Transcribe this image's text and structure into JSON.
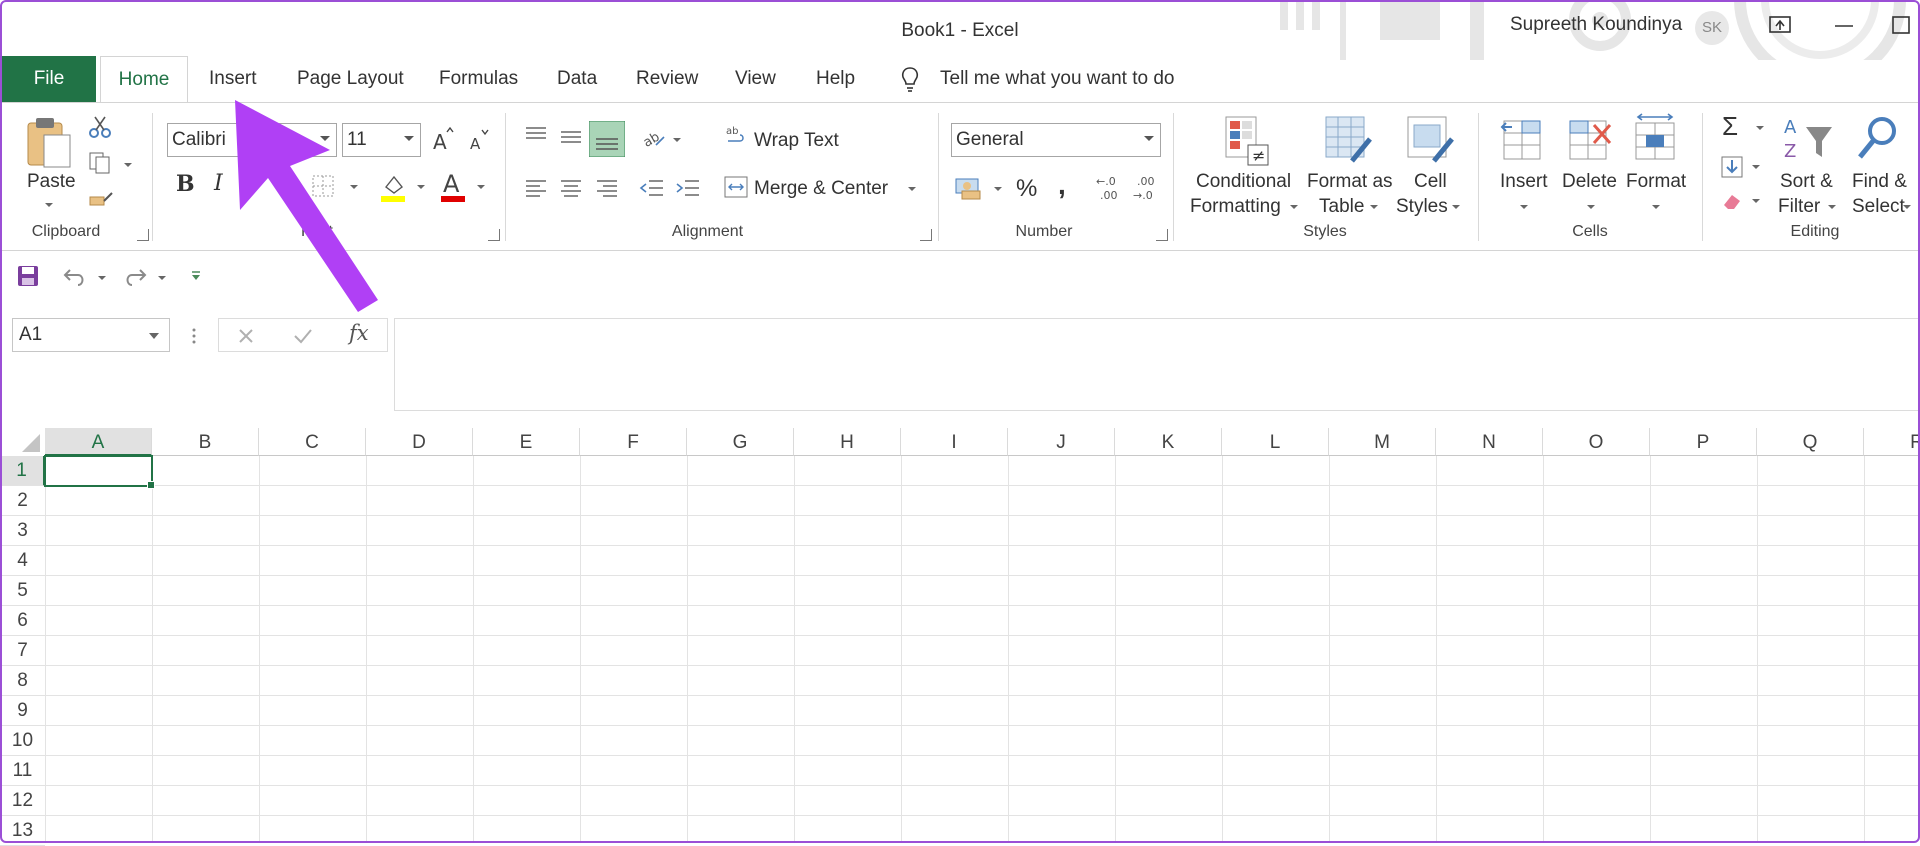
{
  "window": {
    "title": "Book1  -  Excel",
    "user_name": "Supreeth Koundinya",
    "user_initials": "SK"
  },
  "tabs": [
    {
      "label": "File"
    },
    {
      "label": "Home"
    },
    {
      "label": "Insert"
    },
    {
      "label": "Page Layout"
    },
    {
      "label": "Formulas"
    },
    {
      "label": "Data"
    },
    {
      "label": "Review"
    },
    {
      "label": "View"
    },
    {
      "label": "Help"
    }
  ],
  "tell_me": "Tell me what you want to do",
  "ribbon": {
    "clipboard": {
      "label": "Clipboard",
      "paste": "Paste"
    },
    "font": {
      "label": "Font",
      "font_name": "Calibri",
      "font_size": "11",
      "bold": "B",
      "italic": "I"
    },
    "alignment": {
      "label": "Alignment",
      "wrap_text": "Wrap Text",
      "merge_center": "Merge & Center"
    },
    "number": {
      "label": "Number",
      "format": "General",
      "percent": "%",
      "comma": ","
    },
    "styles": {
      "label": "Styles",
      "conditional_1": "Conditional",
      "conditional_2": "Formatting",
      "format_table_1": "Format as",
      "format_table_2": "Table",
      "cell_styles_1": "Cell",
      "cell_styles_2": "Styles"
    },
    "cells": {
      "label": "Cells",
      "insert": "Insert",
      "delete": "Delete",
      "format": "Format"
    },
    "editing": {
      "label": "Editing",
      "sort_1": "Sort &",
      "sort_2": "Filter",
      "find_1": "Find &",
      "find_2": "Select",
      "sigma": "Σ"
    }
  },
  "formula_bar": {
    "name_box": "A1",
    "fx": "fx",
    "value": ""
  },
  "grid": {
    "columns": [
      "A",
      "B",
      "C",
      "D",
      "E",
      "F",
      "G",
      "H",
      "I",
      "J",
      "K",
      "L",
      "M",
      "N",
      "O",
      "P",
      "Q",
      "R"
    ],
    "rows": [
      "1",
      "2",
      "3",
      "4",
      "5",
      "6",
      "7",
      "8",
      "9",
      "10",
      "11",
      "12",
      "13"
    ],
    "active_cell": "A1"
  },
  "colors": {
    "accent": "#217346",
    "annotation_arrow": "#b040f5"
  }
}
